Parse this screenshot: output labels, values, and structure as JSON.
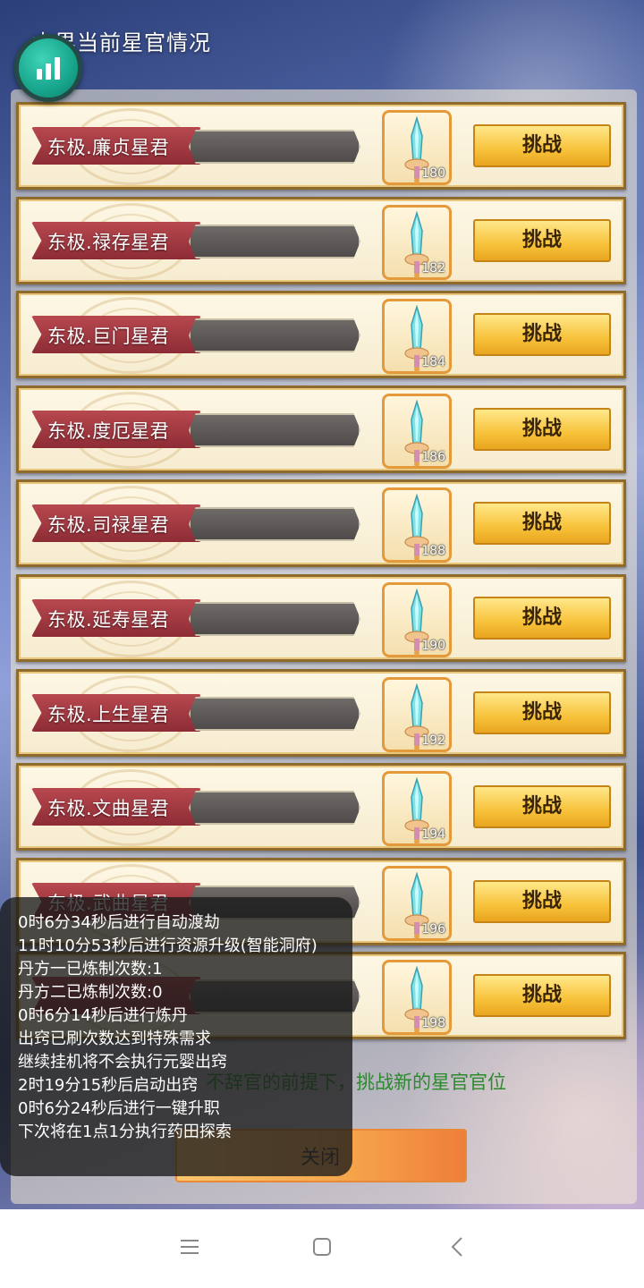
{
  "header": {
    "title": "本界当前星官情况"
  },
  "rows": [
    {
      "title": "东极.廉贞星君",
      "level": "180",
      "button": "挑战"
    },
    {
      "title": "东极.禄存星君",
      "level": "182",
      "button": "挑战"
    },
    {
      "title": "东极.巨门星君",
      "level": "184",
      "button": "挑战"
    },
    {
      "title": "东极.度厄星君",
      "level": "186",
      "button": "挑战"
    },
    {
      "title": "东极.司禄星君",
      "level": "188",
      "button": "挑战"
    },
    {
      "title": "东极.延寿星君",
      "level": "190",
      "button": "挑战"
    },
    {
      "title": "东极.上生星君",
      "level": "192",
      "button": "挑战"
    },
    {
      "title": "东极.文曲星君",
      "level": "194",
      "button": "挑战"
    },
    {
      "title": "东极.武曲星君",
      "level": "196",
      "button": "挑战"
    },
    {
      "title": "",
      "level": "198",
      "button": "挑战"
    }
  ],
  "hint": "不辞官的前提下，挑战新的星官官位",
  "close_label": "关闭",
  "log_lines": [
    "0时6分34秒后进行自动渡劫",
    "11时10分53秒后进行资源升级(智能洞府)",
    "丹方一已炼制次数:1",
    "丹方二已炼制次数:0",
    "0时6分14秒后进行炼丹",
    "出窍已刷次数达到特殊需求",
    "继续挂机将不会执行元婴出窍",
    "2时19分15秒后启动出窍",
    "0时6分24秒后进行一键升职",
    "下次将在1点1分执行药田探索"
  ],
  "colors": {
    "ribbon": "#a33a43",
    "button": "#f7c23a",
    "hint": "#2b8a2b",
    "float_button": "#17a58c"
  },
  "icons": {
    "float_button": "bar-chart-icon",
    "item": "sword-icon",
    "nav": [
      "menu-icon",
      "home-square-icon",
      "back-icon"
    ]
  }
}
